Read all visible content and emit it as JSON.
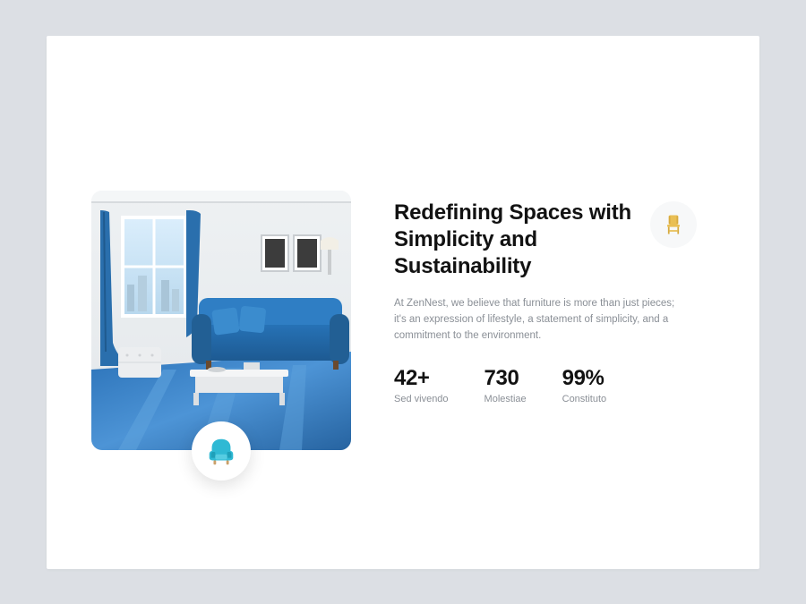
{
  "heading": "Redefining Spaces with Simplicity and Sustainability",
  "description": "At ZenNest, we believe that furniture is more than just pieces; it's an expression of lifestyle, a statement of simplicity, and a commitment to the environment.",
  "stats": [
    {
      "value": "42+",
      "label": "Sed vivendo"
    },
    {
      "value": "730",
      "label": "Molestiae"
    },
    {
      "value": "99%",
      "label": "Constituto"
    }
  ],
  "icons": {
    "armchair": "armchair-icon",
    "chair": "chair-icon"
  }
}
